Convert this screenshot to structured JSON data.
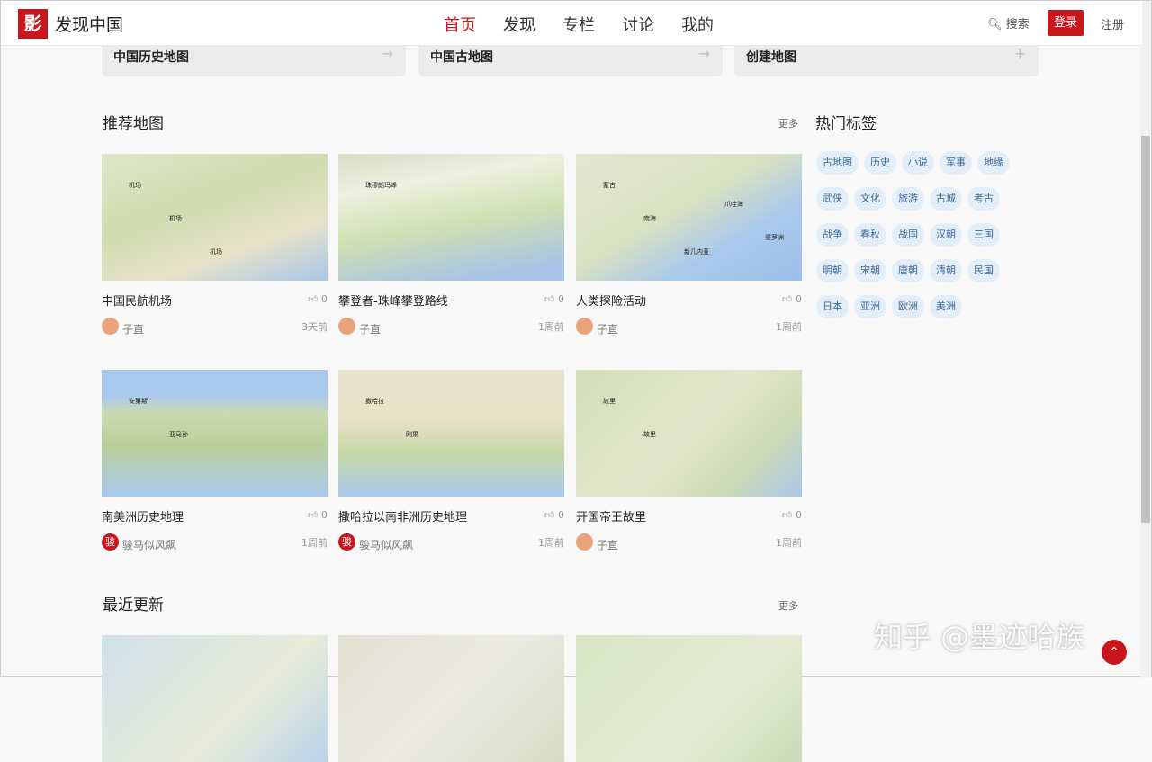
{
  "header": {
    "logo_text": "影",
    "brand": "发现中国",
    "nav": [
      "首页",
      "发现",
      "专栏",
      "讨论",
      "我的"
    ],
    "search": "搜索",
    "login": "登录",
    "register": "注册"
  },
  "top_cards": [
    {
      "label": "中国历史地图",
      "icon": "→"
    },
    {
      "label": "中国古地图",
      "icon": "→"
    },
    {
      "label": "创建地图",
      "icon": "+"
    }
  ],
  "recommended": {
    "title": "推荐地图",
    "more": "更多",
    "cards": [
      {
        "title": "中国民航机场",
        "likes": "0",
        "author": "子直",
        "time": "3天前",
        "avatar": "",
        "thumb": "china",
        "labels": [
          "机场",
          "机场",
          "机场"
        ]
      },
      {
        "title": "攀登者-珠峰攀登路线",
        "likes": "0",
        "author": "子直",
        "time": "1周前",
        "avatar": "",
        "thumb": "everest",
        "labels": [
          "珠穆朗玛峰"
        ]
      },
      {
        "title": "人类探险活动",
        "likes": "0",
        "author": "子直",
        "time": "1周前",
        "avatar": "",
        "thumb": "asia",
        "labels": [
          "蒙古",
          "南海",
          "新几内亚",
          "爪哇海",
          "婆罗洲"
        ]
      },
      {
        "title": "南美洲历史地理",
        "likes": "0",
        "author": "骏马似风飙",
        "time": "1周前",
        "avatar": "骏",
        "thumb": "samerica",
        "labels": [
          "安第斯",
          "亚马孙"
        ]
      },
      {
        "title": "撒哈拉以南非洲历史地理",
        "likes": "0",
        "author": "骏马似风飙",
        "time": "1周前",
        "avatar": "骏",
        "thumb": "africa",
        "labels": [
          "撒哈拉",
          "刚果"
        ]
      },
      {
        "title": "开国帝王故里",
        "likes": "0",
        "author": "子直",
        "time": "1周前",
        "avatar": "",
        "thumb": "china2",
        "labels": [
          "故里",
          "故里"
        ]
      }
    ]
  },
  "recent": {
    "title": "最近更新",
    "more": "更多"
  },
  "sidebar": {
    "title": "热门标签",
    "tags": [
      "古地图",
      "历史",
      "小说",
      "军事",
      "地缘",
      "武侠",
      "文化",
      "旅游",
      "古城",
      "考古",
      "战争",
      "春秋",
      "战国",
      "汉朝",
      "三国",
      "明朝",
      "宋朝",
      "唐朝",
      "清朝",
      "民国",
      "日本",
      "亚洲",
      "欧洲",
      "美洲"
    ]
  },
  "watermark": "知乎 @墨迹哈族",
  "to_top": "⌃"
}
